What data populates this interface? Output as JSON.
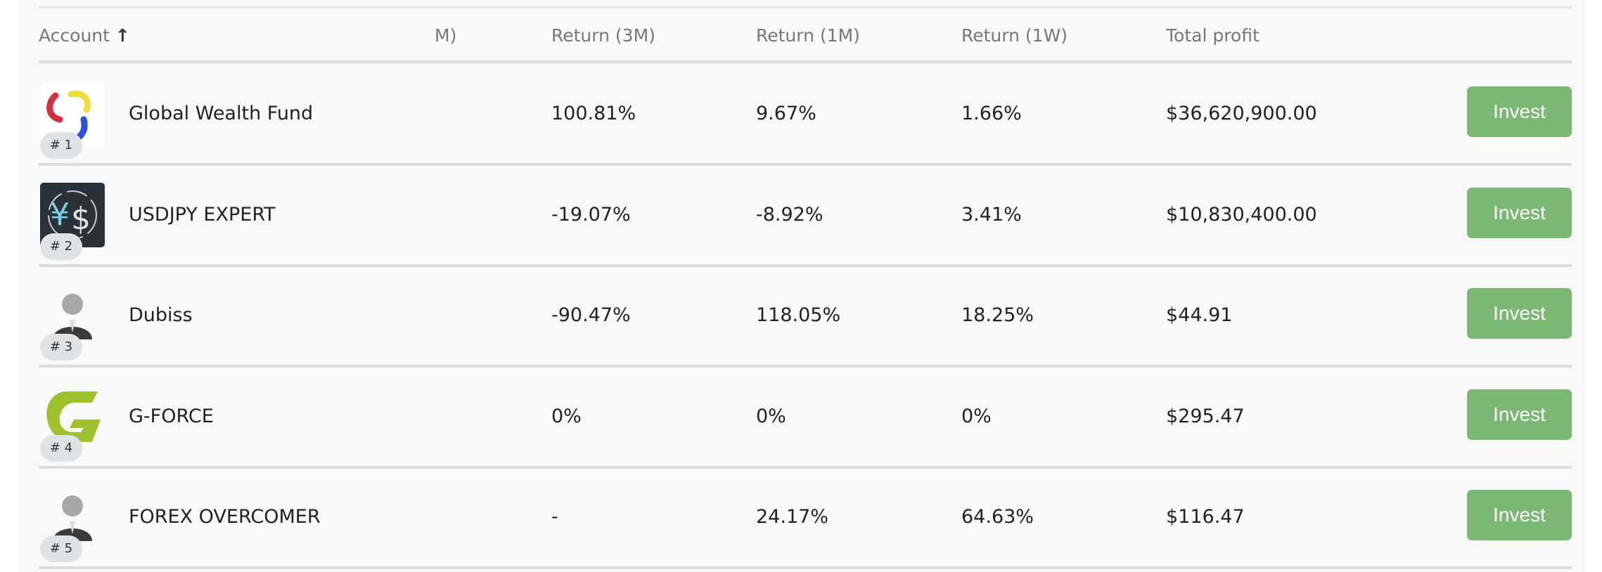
{
  "header": {
    "account": "Account",
    "sort_icon": "arrow-up-icon",
    "truncated": "M)",
    "return_3m": "Return (3M)",
    "return_1m": "Return (1M)",
    "return_1w": "Return (1W)",
    "total_profit": "Total profit"
  },
  "rows": [
    {
      "rank": "# 1",
      "name": "Global Wealth Fund",
      "avatar": "swirl-logo",
      "return_3m": "100.81%",
      "return_1m": "9.67%",
      "return_1w": "1.66%",
      "total_profit": "$36,620,900.00",
      "action": "Invest"
    },
    {
      "rank": "# 2",
      "name": "USDJPY EXPERT",
      "avatar": "yen-dollar-logo",
      "return_3m": "-19.07%",
      "return_1m": "-8.92%",
      "return_1w": "3.41%",
      "total_profit": "$10,830,400.00",
      "action": "Invest"
    },
    {
      "rank": "# 3",
      "name": "Dubiss",
      "avatar": "default-user",
      "return_3m": "-90.47%",
      "return_1m": "118.05%",
      "return_1w": "18.25%",
      "total_profit": "$44.91",
      "action": "Invest"
    },
    {
      "rank": "# 4",
      "name": "G-FORCE",
      "avatar": "g-logo",
      "return_3m": "0%",
      "return_1m": "0%",
      "return_1w": "0%",
      "total_profit": "$295.47",
      "action": "Invest"
    },
    {
      "rank": "# 5",
      "name": "FOREX OVERCOMER",
      "avatar": "default-user",
      "return_3m": "-",
      "return_1m": "24.17%",
      "return_1w": "64.63%",
      "total_profit": "$116.47",
      "action": "Invest"
    }
  ],
  "colors": {
    "invest_button": "#7ab874",
    "background": "#f9f9f9"
  }
}
